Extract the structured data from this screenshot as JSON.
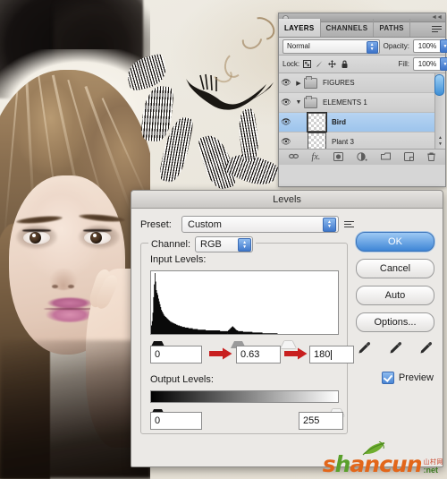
{
  "app": {
    "name": "Adobe Photoshop",
    "scene_description": "Photoshop Levels adjustment dialog over a photo montage"
  },
  "layers_panel": {
    "tabs": [
      {
        "label": "LAYERS",
        "active": true
      },
      {
        "label": "CHANNELS",
        "active": false
      },
      {
        "label": "PATHS",
        "active": false
      }
    ],
    "menu_icon": "panel-menu-icon",
    "blend_mode": "Normal",
    "opacity_label": "Opacity:",
    "opacity_value": "100%",
    "lock_label": "Lock:",
    "lock_icons": [
      "lock-transparent-pixels-icon",
      "lock-image-pixels-icon",
      "lock-position-icon",
      "lock-all-icon"
    ],
    "fill_label": "Fill:",
    "fill_value": "100%",
    "layers": [
      {
        "name": "FIGURES",
        "type": "group",
        "expanded": false,
        "visible": true,
        "selected": false,
        "indent": 0
      },
      {
        "name": "ELEMENTS 1",
        "type": "group",
        "expanded": true,
        "visible": true,
        "selected": false,
        "indent": 0
      },
      {
        "name": "Bird",
        "type": "layer",
        "visible": true,
        "selected": true,
        "indent": 1
      },
      {
        "name": "Plant 3",
        "type": "layer",
        "visible": true,
        "selected": false,
        "indent": 1
      }
    ],
    "footer_buttons": [
      {
        "icon": "link-layers-icon",
        "glyph": "∞"
      },
      {
        "icon": "layer-style-fx-icon",
        "glyph": "fx."
      },
      {
        "icon": "layer-mask-icon",
        "glyph": "◱"
      },
      {
        "icon": "adjustment-layer-icon",
        "glyph": "◐."
      },
      {
        "icon": "new-group-icon",
        "glyph": "▭"
      },
      {
        "icon": "new-layer-icon",
        "glyph": "◲"
      },
      {
        "icon": "delete-layer-icon",
        "glyph": "🗑"
      }
    ]
  },
  "levels_dialog": {
    "title": "Levels",
    "preset_label": "Preset:",
    "preset_value": "Custom",
    "preset_options_icon": "preset-options-icon",
    "channel_label": "Channel:",
    "channel_value": "RGB",
    "input_levels_label": "Input Levels:",
    "input_black": "0",
    "input_gamma": "0.63",
    "input_white": "180",
    "output_levels_label": "Output Levels:",
    "output_black": "0",
    "output_white": "255",
    "buttons": [
      {
        "label": "OK",
        "primary": true
      },
      {
        "label": "Cancel",
        "primary": false
      },
      {
        "label": "Auto",
        "primary": false
      },
      {
        "label": "Options...",
        "primary": false
      }
    ],
    "eyedroppers": [
      "set-black-point-eyedropper",
      "set-gray-point-eyedropper",
      "set-white-point-eyedropper"
    ],
    "preview_label": "Preview",
    "preview_checked": true,
    "annotation_arrows": [
      {
        "target": "input-gamma-field",
        "color": "#c81f1f"
      },
      {
        "target": "input-white-field",
        "color": "#c81f1f"
      }
    ]
  },
  "histogram": {
    "bins": [
      12,
      18,
      30,
      52,
      70,
      86,
      74,
      62,
      58,
      55,
      50,
      46,
      42,
      38,
      34,
      32,
      30,
      28,
      26,
      25,
      24,
      23,
      22,
      21,
      20,
      19,
      18,
      17,
      17,
      16,
      16,
      15,
      15,
      14,
      14,
      13,
      13,
      12,
      12,
      12,
      11,
      11,
      11,
      10,
      10,
      10,
      10,
      9,
      9,
      9,
      9,
      9,
      8,
      8,
      8,
      8,
      8,
      8,
      7,
      7,
      7,
      7,
      7,
      7,
      7,
      6,
      6,
      6,
      6,
      6,
      6,
      6,
      6,
      6,
      6,
      6,
      5,
      5,
      5,
      5,
      5,
      5,
      5,
      5,
      5,
      5,
      5,
      5,
      5,
      5,
      5,
      5,
      5,
      5,
      5,
      5,
      4,
      4,
      4,
      4,
      4,
      4,
      4,
      4,
      4,
      4,
      4,
      5,
      6,
      7,
      8,
      9,
      10,
      11,
      10,
      9,
      8,
      7,
      6,
      5,
      5,
      4,
      4,
      4,
      4,
      4,
      4,
      4,
      3,
      3,
      3,
      3,
      3,
      3,
      3,
      3,
      3,
      3,
      3,
      3,
      3,
      2,
      2,
      2,
      2,
      2,
      2,
      2,
      2,
      2,
      2,
      2,
      2,
      2,
      2,
      1,
      1,
      1,
      1,
      1,
      1,
      1,
      1,
      1,
      1,
      1,
      1,
      1,
      1,
      1,
      1,
      1,
      1,
      1,
      1,
      1,
      0,
      0,
      0,
      0,
      0,
      0,
      0,
      0,
      0,
      0,
      0,
      0,
      0,
      0,
      0,
      0,
      0,
      0,
      0,
      0,
      0,
      0,
      0,
      0,
      0,
      0,
      0,
      0,
      0,
      0,
      0,
      0,
      0,
      0,
      0,
      0,
      0,
      0,
      0,
      0,
      0,
      0,
      0,
      0,
      0,
      0,
      0,
      0,
      0,
      0,
      0,
      0,
      0,
      0,
      0,
      0,
      0,
      0,
      0,
      0,
      0,
      0,
      0,
      0,
      0,
      0,
      0,
      0,
      0,
      0,
      0,
      0,
      0,
      0,
      0,
      0,
      0,
      0,
      0,
      0,
      0,
      0,
      0,
      0
    ]
  },
  "watermark": {
    "text_a": "s",
    "text_b": "h",
    "text_c": "ancun",
    "cn": "山村网",
    "domain": ":net"
  }
}
